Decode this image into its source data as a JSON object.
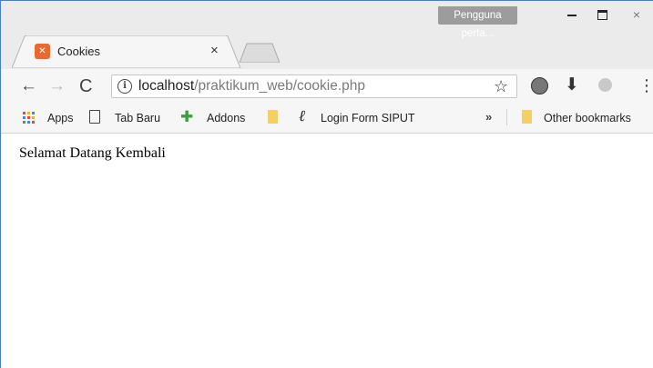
{
  "window": {
    "user_badge": "Pengguna perta...",
    "close_symbol": "×"
  },
  "tab": {
    "title": "Cookies",
    "close_symbol": "×",
    "favicon": "xampp-icon"
  },
  "toolbar": {
    "url_host": "localhost",
    "url_path": "/praktikum_web/cookie.php",
    "back_symbol": "←",
    "forward_symbol": "→",
    "reload_symbol": "C",
    "info_symbol": "i",
    "star_symbol": "☆",
    "download_symbol": "⬇",
    "menu_symbol": "⋮"
  },
  "bookmarks": {
    "items": [
      {
        "label": "Apps",
        "icon": "apps-grid-icon"
      },
      {
        "label": "Tab Baru",
        "icon": "page-icon"
      },
      {
        "label": "Addons",
        "icon": "puzzle-icon"
      },
      {
        "label": "",
        "icon": "folder-icon"
      },
      {
        "label": "Login Form SIPUT",
        "icon": "l-logo-icon"
      }
    ],
    "overflow_symbol": "»",
    "other": "Other bookmarks"
  },
  "page": {
    "message": "Selamat Datang Kembali"
  },
  "colors": {
    "chrome_bg": "#ebebeb",
    "toolbar_bg": "#f6f6f6",
    "badge_bg": "#9c9c9c",
    "favicon": "#e86a2e",
    "folder": "#f4cf62",
    "puzzle": "#3e9b3e"
  }
}
